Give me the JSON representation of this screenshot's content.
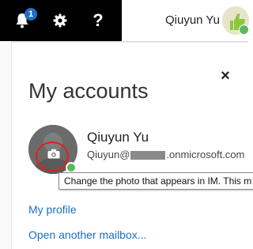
{
  "header": {
    "notification_count": "1",
    "help_label": "?",
    "user_name": "Qiuyun Yu",
    "status_color": "#5cb85c",
    "icons": [
      "bell-icon",
      "gear-icon",
      "help-icon"
    ]
  },
  "panel": {
    "title": "My accounts",
    "close_label": "×",
    "account": {
      "name": "Qiuyun Yu",
      "email_prefix": "Qiuyun@",
      "email_suffix": ".onmicrosoft.com"
    },
    "tooltip": "Change the photo that appears in IM. This m",
    "links": {
      "profile": "My profile",
      "another_mailbox": "Open another mailbox..."
    }
  },
  "colors": {
    "accent": "#1a6fc4",
    "badge": "#1f6fc5",
    "highlight_ring": "#e0201c"
  }
}
